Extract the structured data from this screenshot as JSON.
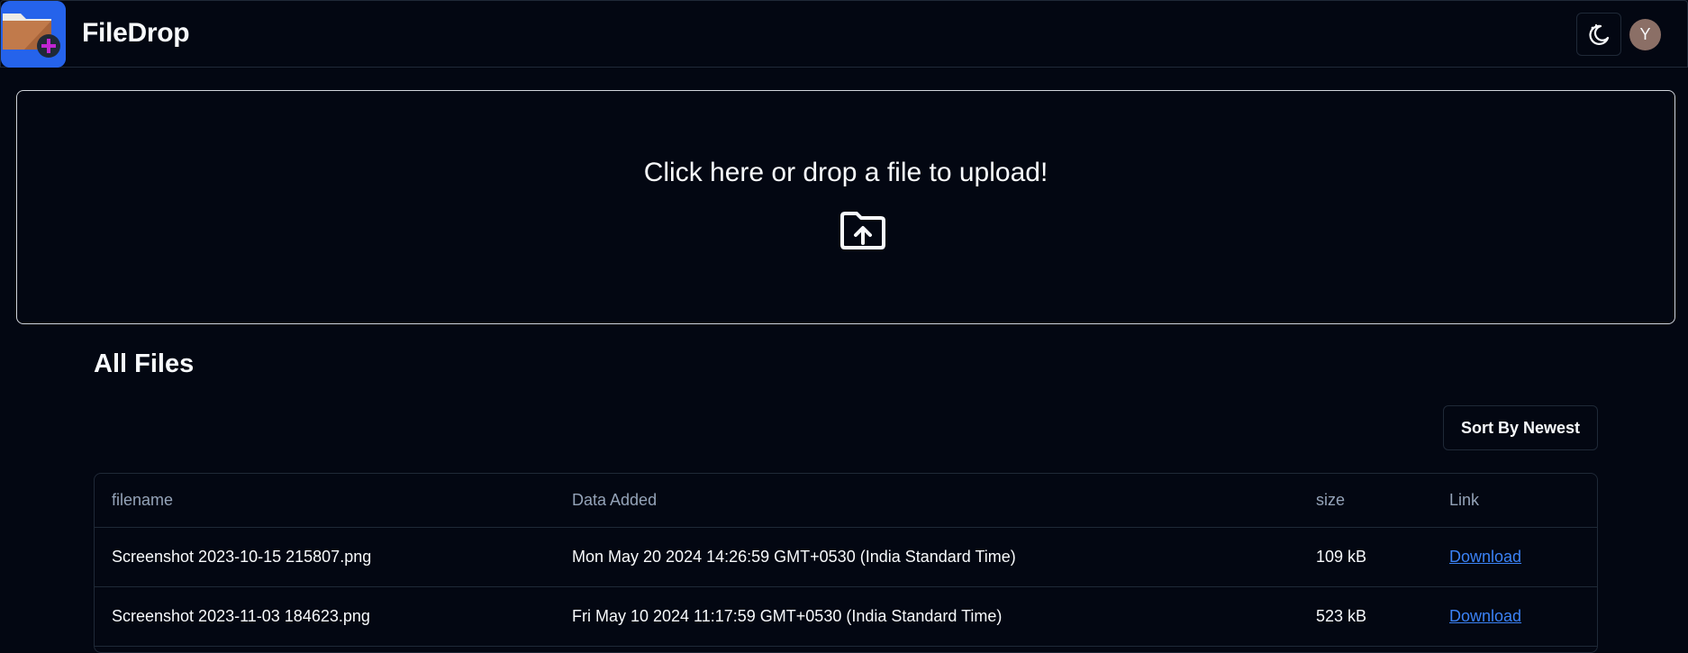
{
  "header": {
    "app_title": "FileDrop",
    "avatar_letter": "Y",
    "logo_icon": "folder-plus-icon",
    "theme_icon": "moon-stars-icon"
  },
  "upload": {
    "prompt": "Click here or drop a file to upload!",
    "icon": "folder-upload-icon"
  },
  "files": {
    "title": "All Files",
    "sort_label": "Sort By Newest",
    "columns": [
      "filename",
      "Data Added",
      "size",
      "Link"
    ],
    "rows": [
      {
        "filename": "Screenshot 2023-10-15 215807.png",
        "date_added": "Mon May 20 2024 14:26:59 GMT+0530 (India Standard Time)",
        "size": "109 kB",
        "link": "Download"
      },
      {
        "filename": "Screenshot 2023-11-03 184623.png",
        "date_added": "Fri May 10 2024 11:17:59 GMT+0530 (India Standard Time)",
        "size": "523 kB",
        "link": "Download"
      }
    ]
  },
  "colors": {
    "background": "#030712",
    "logo_bg": "#2563eb",
    "link": "#3b82f6",
    "avatar": "#8b6f66"
  }
}
